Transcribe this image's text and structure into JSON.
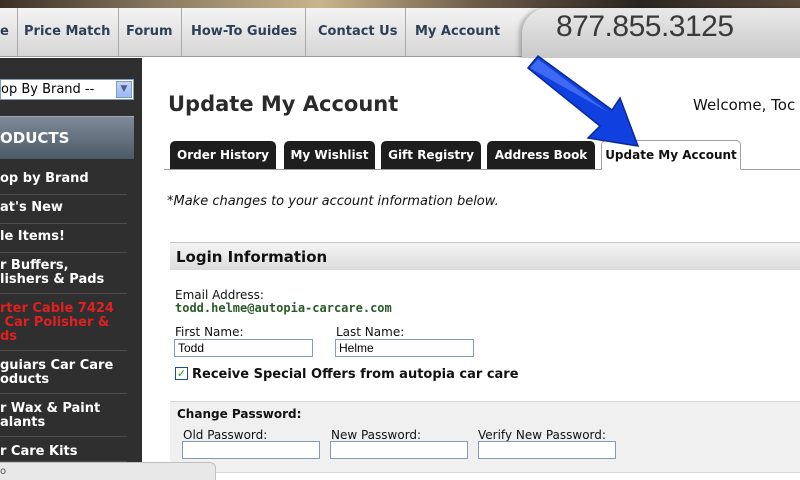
{
  "nav": {
    "items": [
      "e",
      "Price Match",
      "Forum",
      "How-To Guides",
      "Contact Us",
      "My Account"
    ],
    "phone": "877.855.3125"
  },
  "sidebar": {
    "brand_select": "op By Brand --",
    "header": "ODUCTS",
    "items": [
      {
        "label": "op by Brand",
        "color": "#ffffff"
      },
      {
        "label": "at's New",
        "color": "#ffffff"
      },
      {
        "label": "le Items!",
        "color": "#ffffff"
      },
      {
        "label": "r Buffers,\nlishers & Pads",
        "color": "#ffffff"
      },
      {
        "label": "rter Cable 7424\n Car Polisher &\nds",
        "color": "#e02020"
      },
      {
        "label": "guiars Car Care\noducts",
        "color": "#ffffff"
      },
      {
        "label": "r Wax & Paint\nalants",
        "color": "#ffffff"
      },
      {
        "label": "r Care Kits",
        "color": "#ffffff"
      }
    ],
    "status_text": "o"
  },
  "main": {
    "title": "Update My Account",
    "welcome": "Welcome, Toc",
    "tabs": [
      {
        "label": "Order History",
        "active": false
      },
      {
        "label": "My Wishlist",
        "active": false
      },
      {
        "label": "Gift Registry",
        "active": false
      },
      {
        "label": "Address Book",
        "active": false
      },
      {
        "label": "Update My Account",
        "active": true
      }
    ],
    "instructions": "*Make changes to your account information below.",
    "login": {
      "header": "Login Information",
      "email_label": "Email Address:",
      "email_value": "todd.helme@autopia-carcare.com",
      "first_name_label": "First Name:",
      "first_name_value": "Todd",
      "last_name_label": "Last Name:",
      "last_name_value": "Helme",
      "offers_checked": true,
      "offers_label": "Receive Special Offers from autopia car care"
    },
    "password": {
      "title": "Change Password:",
      "old_label": "Old Password:",
      "new_label": "New Password:",
      "verify_label": "Verify New Password:",
      "old_value": "",
      "new_value": "",
      "verify_value": ""
    }
  },
  "colors": {
    "accent_arrow": "#1040e0",
    "nav_text": "#2d3f55",
    "email_text": "#2a5a2a",
    "promo_red": "#e02020"
  },
  "icons": [
    "dropdown-arrow-icon",
    "pointer-arrow-icon",
    "checkmark-icon"
  ]
}
